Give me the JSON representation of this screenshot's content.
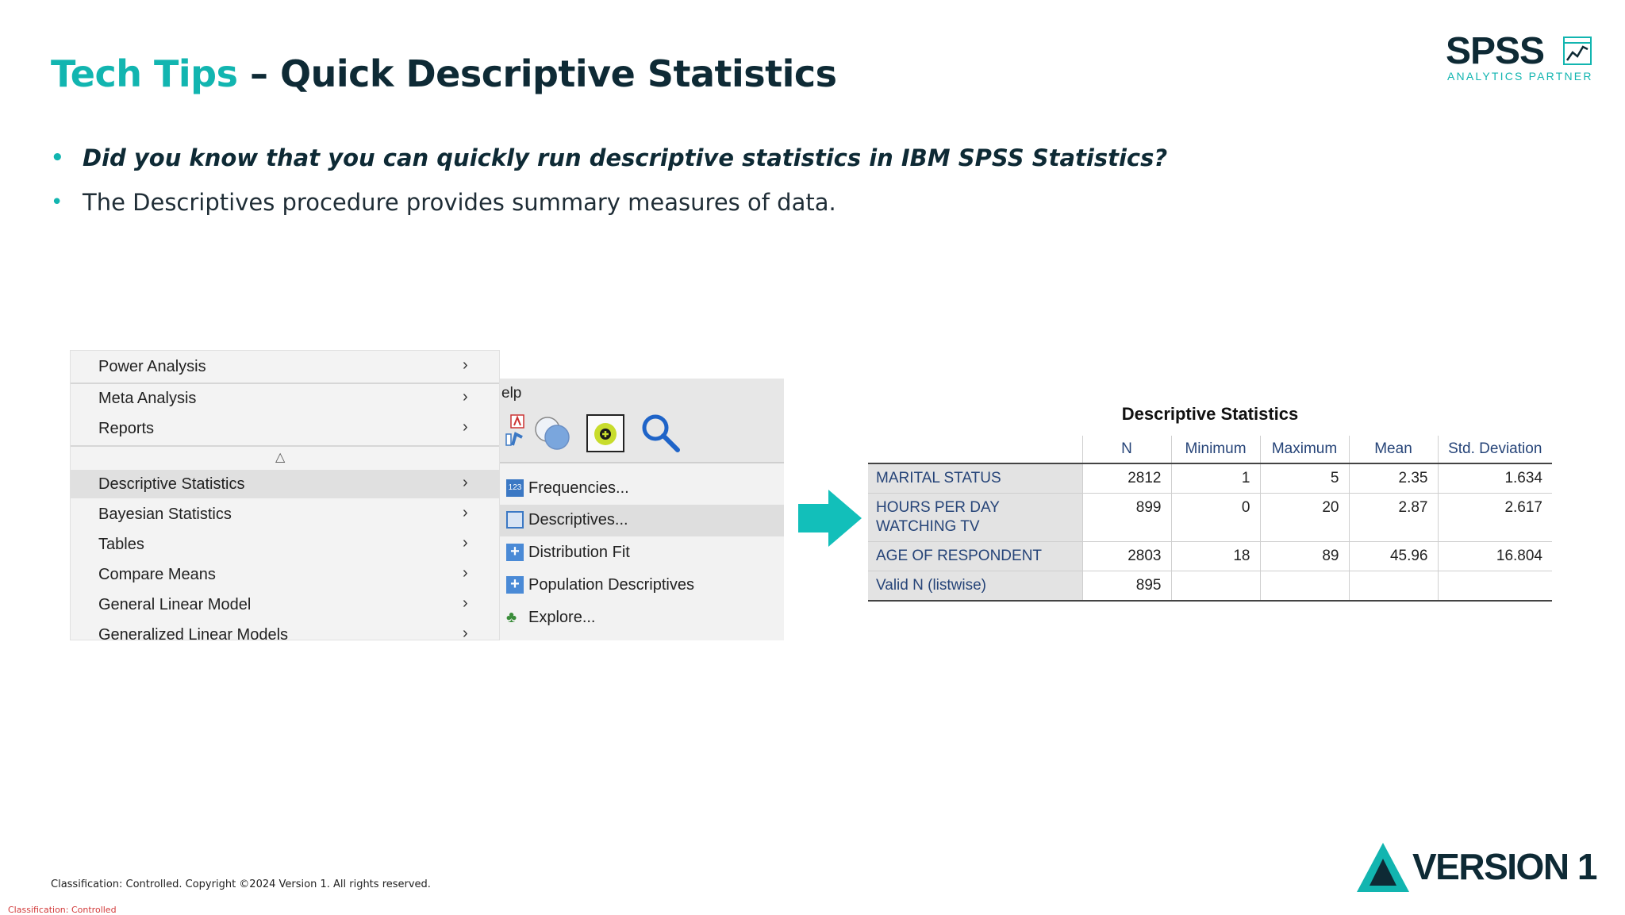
{
  "slide": {
    "title_accent": "Tech Tips",
    "title_rest": " – Quick Descriptive Statistics",
    "bullets": [
      "Did you know that you can quickly run descriptive statistics in IBM SPSS Statistics?",
      "The Descriptives procedure provides summary measures of data."
    ]
  },
  "logo": {
    "word": "SPSS",
    "sub": "ANALYTICS PARTNER"
  },
  "analyze_menu": {
    "items": [
      {
        "label": "Power Analysis"
      },
      {
        "label": "Meta Analysis"
      },
      {
        "label": "Reports"
      },
      {
        "label": "Descriptive Statistics",
        "highlighted": true
      },
      {
        "label": "Bayesian Statistics"
      },
      {
        "label": "Tables"
      },
      {
        "label": "Compare Means"
      },
      {
        "label": "General Linear Model"
      },
      {
        "label": "Generalized Linear Models"
      }
    ],
    "chevron": "›",
    "scroll_marker": "△"
  },
  "submenu": {
    "toolbar_help": "elp",
    "items": [
      {
        "label": "Frequencies...",
        "icon": "frequencies-icon"
      },
      {
        "label": "Descriptives...",
        "icon": "descriptives-icon",
        "highlighted": true
      },
      {
        "label": "Distribution Fit",
        "icon": "plus-icon"
      },
      {
        "label": "Population Descriptives",
        "icon": "plus-icon"
      },
      {
        "label": "Explore...",
        "icon": "explore-icon"
      }
    ],
    "freq_icon_text": "123",
    "plus_glyph": "+",
    "explore_glyph": "♣"
  },
  "colors": {
    "accent": "#12b5b0",
    "dark": "#0e2a35",
    "label_blue": "#264478",
    "classification_red": "#d23a3a"
  },
  "output_table": {
    "title": "Descriptive Statistics",
    "columns": [
      "",
      "N",
      "Minimum",
      "Maximum",
      "Mean",
      "Std. Deviation"
    ],
    "rows": [
      {
        "label": "MARITAL STATUS",
        "cells": [
          "2812",
          "1",
          "5",
          "2.35",
          "1.634"
        ]
      },
      {
        "label": "HOURS PER DAY WATCHING TV",
        "cells": [
          "899",
          "0",
          "20",
          "2.87",
          "2.617"
        ]
      },
      {
        "label": "AGE OF RESPONDENT",
        "cells": [
          "2803",
          "18",
          "89",
          "45.96",
          "16.804"
        ]
      },
      {
        "label": "Valid N (listwise)",
        "cells": [
          "895",
          "",
          "",
          "",
          ""
        ]
      }
    ]
  },
  "footer": {
    "copyright": "Classification: Controlled. Copyright ©2024 Version 1. All rights reserved.",
    "classification": "Classification: Controlled",
    "brand": "VERSION 1"
  }
}
